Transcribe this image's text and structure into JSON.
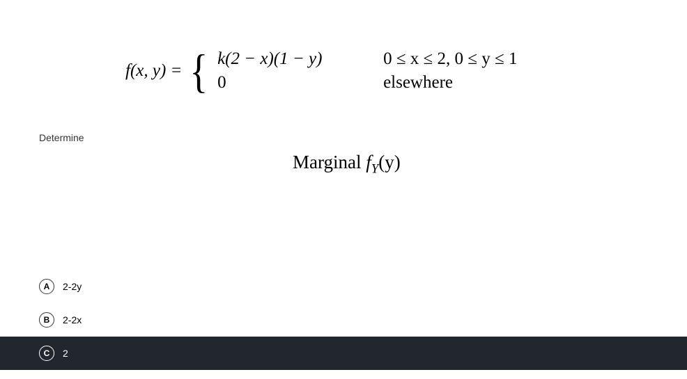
{
  "equation": {
    "lhs": "f(x, y) =",
    "case1_val": "k(2 − x)(1 − y)",
    "case1_cond": "0 ≤ x ≤ 2, 0 ≤ y ≤ 1",
    "case2_val": "0",
    "case2_cond": "elsewhere"
  },
  "prompt": "Determine",
  "marginal_label": "Marginal ",
  "marginal_fn": "f",
  "marginal_sub": "Y",
  "marginal_arg": "(y)",
  "options": [
    {
      "letter": "A",
      "text": "2-2y",
      "selected": false
    },
    {
      "letter": "B",
      "text": "2-2x",
      "selected": false
    },
    {
      "letter": "C",
      "text": "2",
      "selected": true
    }
  ]
}
